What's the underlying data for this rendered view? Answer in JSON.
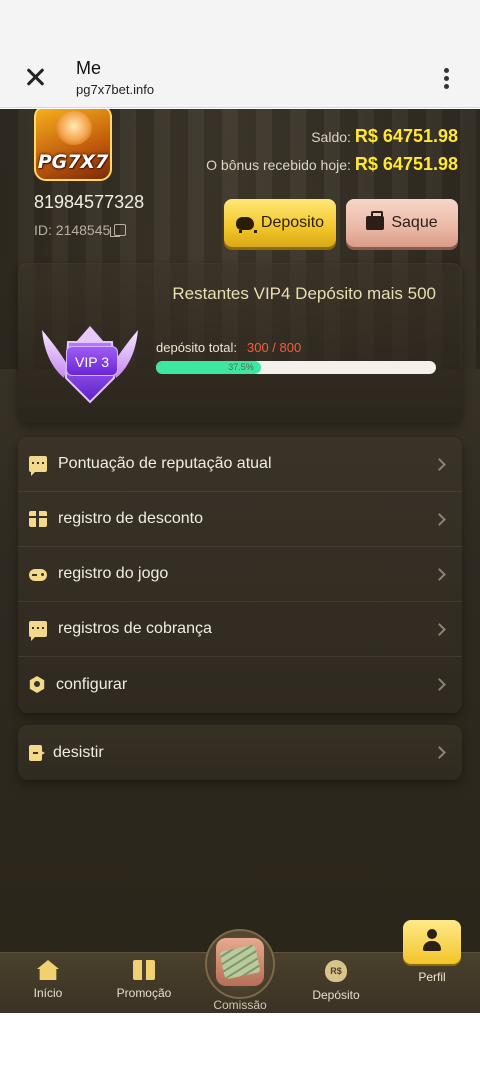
{
  "browser": {
    "title": "Me",
    "url": "pg7x7bet.info"
  },
  "header": {
    "logo_text": "PG7X7",
    "saldo_label": "Saldo:",
    "saldo_value": "R$ 64751.98",
    "bonus_label": "O bônus recebido hoje:",
    "bonus_value": "R$ 64751.98",
    "phone": "81984577328",
    "id_text": "ID: 2148545",
    "deposit_button": "Deposito",
    "withdraw_button": "Saque"
  },
  "vip": {
    "next_text": "Restantes VIP4 Depósito mais 500",
    "badge": "VIP 3",
    "deposit_total_label": "depósito total:",
    "deposit_total_value": "300 / 800",
    "progress_percent": 37.5,
    "progress_text": "37.5%"
  },
  "menu": {
    "items": [
      {
        "label": "Pontuação de reputação atual",
        "icon": "chat-icon"
      },
      {
        "label": "registro de desconto",
        "icon": "gift-icon"
      },
      {
        "label": "registro do jogo",
        "icon": "gamepad-icon"
      },
      {
        "label": "registros de cobrança",
        "icon": "chat-icon"
      },
      {
        "label": "configurar",
        "icon": "settings-icon"
      }
    ],
    "logout": "desistir"
  },
  "bottom_nav": {
    "items": [
      {
        "label": "Início",
        "icon": "home-icon"
      },
      {
        "label": "Promoção",
        "icon": "gift-icon"
      },
      {
        "label": "Comissão",
        "icon": "cash-icon"
      },
      {
        "label": "Depósito",
        "icon": "coin-bag-icon"
      },
      {
        "label": "Perfil",
        "icon": "user-icon",
        "active": true
      }
    ],
    "coin_text": "R$"
  },
  "colors": {
    "accent_yellow": "#ffe834",
    "progress_green": "#3ee6a0",
    "deposit_value_red": "#ff5a3a",
    "background": "#3a342a"
  }
}
